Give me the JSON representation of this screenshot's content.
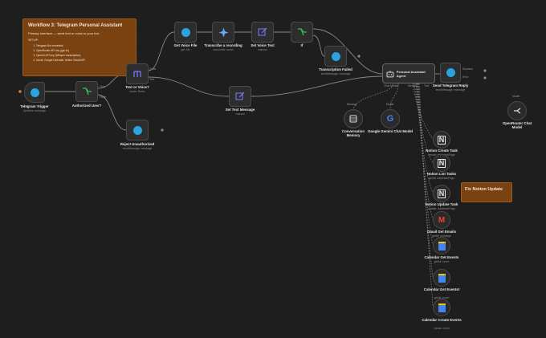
{
  "workflow_note": {
    "title": "Workflow 3: Telegram Personal Assistant",
    "description": "Primary interface — send text or voice to your bot.",
    "setup_heading": "SETUP:",
    "steps": [
      "Telegram Bot credential",
      "OpenRouter API key (gpt-4o)",
      "OpenAI API key (Whisper transcription)",
      "Gmail, Google Calendar, Notion OAuth/API"
    ]
  },
  "fix_note": {
    "text": "Fix Notion Update"
  },
  "nodes": {
    "telegram_trigger": {
      "title": "Telegram Trigger",
      "subtitle": "Updates: message"
    },
    "authorized_user": {
      "title": "Authorized User?",
      "subtitle": ""
    },
    "text_or_voice": {
      "title": "Text or Voice?",
      "subtitle": "mode: Rules"
    },
    "get_voice_file": {
      "title": "Get Voice File",
      "subtitle": "get: file"
    },
    "transcribe": {
      "title": "Transcribe a recording",
      "subtitle": "transcribe: audio"
    },
    "set_voice_text": {
      "title": "Set Voice Text",
      "subtitle": "manual"
    },
    "if_node": {
      "title": "If",
      "subtitle": ""
    },
    "transcription_failed": {
      "title": "Transcription Failed",
      "subtitle": "sendMessage: message"
    },
    "set_text_message": {
      "title": "Set Text Message",
      "subtitle": "manual"
    },
    "reject_unauthorized": {
      "title": "Reject Unauthorized",
      "subtitle": "sendMessage: message"
    },
    "agent": {
      "title": "Personal Assistant Agent",
      "subtitle": ""
    },
    "send_reply": {
      "title": "Send Telegram Reply",
      "subtitle": "sendMessage: message"
    },
    "memory": {
      "title": "Conversation Memory",
      "subtitle": ""
    },
    "gemini": {
      "title": "Google Gemini Chat Model",
      "subtitle": ""
    },
    "openrouter": {
      "title": "OpenRouter Chat Model",
      "subtitle": ""
    },
    "notion_create": {
      "title": "Notion Create Task",
      "subtitle": "create: databasePage"
    },
    "notion_list": {
      "title": "Notion List Tasks",
      "subtitle": "getAll: databasePage"
    },
    "notion_update": {
      "title": "Notion Update Task",
      "subtitle": "update: databasePage"
    },
    "gmail_get": {
      "title": "Gmail Get Emails",
      "subtitle": "getAll: message"
    },
    "cal_get": {
      "title": "Calendar Get Events",
      "subtitle": "getAll: event"
    },
    "cal_get_event": {
      "title": "Calendar Get Eventst",
      "subtitle": "getAll: event"
    },
    "cal_create": {
      "title": "Calendar Create Events",
      "subtitle": "create: event"
    }
  },
  "ports": {
    "true_label": "True",
    "false_label": "False",
    "voice_label": "Voice",
    "text_label": "Text",
    "success_label": "Success",
    "error_label": "Error",
    "memory_label": "Memory",
    "model_label": "Model",
    "chat_model_label": "Chat Model*",
    "tool_label": "Tool"
  },
  "colors": {
    "canvas": "#1e1e1e",
    "note": "#7a4210",
    "telegram": "#2aa3df",
    "filter": "#3fb950",
    "edit": "#7c7cff",
    "edge": "#8a8a8a",
    "agent_border": "#6a6a6a"
  }
}
